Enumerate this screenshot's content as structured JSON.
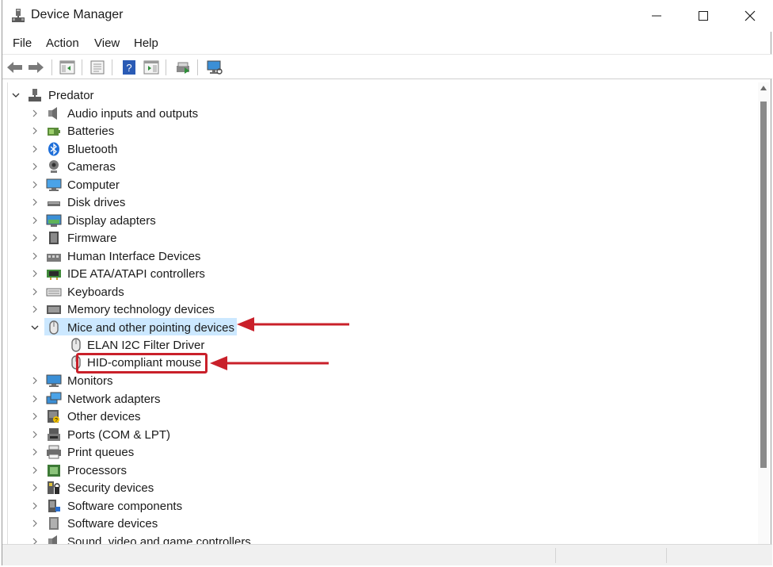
{
  "window": {
    "title": "Device Manager"
  },
  "menubar": {
    "items": [
      "File",
      "Action",
      "View",
      "Help"
    ]
  },
  "toolbar": {
    "buttons": [
      "back-icon",
      "forward-icon",
      "show-hide-console-tree-icon",
      "properties-icon",
      "help-icon",
      "action-pane-icon",
      "update-driver-icon",
      "scan-hardware-icon"
    ]
  },
  "tree": {
    "root": "Predator",
    "categories": [
      "Audio inputs and outputs",
      "Batteries",
      "Bluetooth",
      "Cameras",
      "Computer",
      "Disk drives",
      "Display adapters",
      "Firmware",
      "Human Interface Devices",
      "IDE ATA/ATAPI controllers",
      "Keyboards",
      "Memory technology devices",
      "Mice and other pointing devices",
      "Monitors",
      "Network adapters",
      "Other devices",
      "Ports (COM & LPT)",
      "Print queues",
      "Processors",
      "Security devices",
      "Software components",
      "Software devices",
      "Sound, video and game controllers"
    ],
    "expanded_category": "Mice and other pointing devices",
    "children": [
      "ELAN I2C Filter Driver",
      "HID-compliant mouse"
    ]
  },
  "colors": {
    "selection": "#cce8ff",
    "annotation": "#c9202a"
  }
}
